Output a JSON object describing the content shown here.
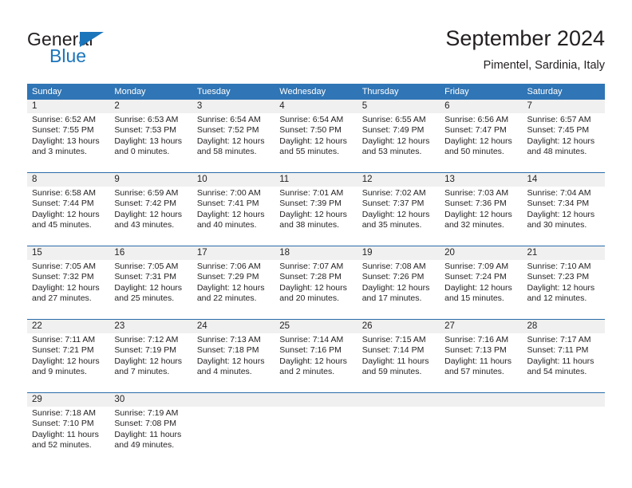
{
  "brand": {
    "name_part1": "General",
    "name_part2": "Blue",
    "color_dark": "#231f20",
    "color_blue": "#1b75bb"
  },
  "header": {
    "title": "September 2024",
    "subtitle": "Pimentel, Sardinia, Italy"
  },
  "theme": {
    "header_blue": "#3075b5",
    "row_divider_blue": "#2a6ca8",
    "daynum_band": "#f0f0f0",
    "text": "#231f20"
  },
  "weekdays": [
    "Sunday",
    "Monday",
    "Tuesday",
    "Wednesday",
    "Thursday",
    "Friday",
    "Saturday"
  ],
  "weeks": [
    [
      {
        "day": "1",
        "info": "Sunrise: 6:52 AM\nSunset: 7:55 PM\nDaylight: 13 hours\nand 3 minutes."
      },
      {
        "day": "2",
        "info": "Sunrise: 6:53 AM\nSunset: 7:53 PM\nDaylight: 13 hours\nand 0 minutes."
      },
      {
        "day": "3",
        "info": "Sunrise: 6:54 AM\nSunset: 7:52 PM\nDaylight: 12 hours\nand 58 minutes."
      },
      {
        "day": "4",
        "info": "Sunrise: 6:54 AM\nSunset: 7:50 PM\nDaylight: 12 hours\nand 55 minutes."
      },
      {
        "day": "5",
        "info": "Sunrise: 6:55 AM\nSunset: 7:49 PM\nDaylight: 12 hours\nand 53 minutes."
      },
      {
        "day": "6",
        "info": "Sunrise: 6:56 AM\nSunset: 7:47 PM\nDaylight: 12 hours\nand 50 minutes."
      },
      {
        "day": "7",
        "info": "Sunrise: 6:57 AM\nSunset: 7:45 PM\nDaylight: 12 hours\nand 48 minutes."
      }
    ],
    [
      {
        "day": "8",
        "info": "Sunrise: 6:58 AM\nSunset: 7:44 PM\nDaylight: 12 hours\nand 45 minutes."
      },
      {
        "day": "9",
        "info": "Sunrise: 6:59 AM\nSunset: 7:42 PM\nDaylight: 12 hours\nand 43 minutes."
      },
      {
        "day": "10",
        "info": "Sunrise: 7:00 AM\nSunset: 7:41 PM\nDaylight: 12 hours\nand 40 minutes."
      },
      {
        "day": "11",
        "info": "Sunrise: 7:01 AM\nSunset: 7:39 PM\nDaylight: 12 hours\nand 38 minutes."
      },
      {
        "day": "12",
        "info": "Sunrise: 7:02 AM\nSunset: 7:37 PM\nDaylight: 12 hours\nand 35 minutes."
      },
      {
        "day": "13",
        "info": "Sunrise: 7:03 AM\nSunset: 7:36 PM\nDaylight: 12 hours\nand 32 minutes."
      },
      {
        "day": "14",
        "info": "Sunrise: 7:04 AM\nSunset: 7:34 PM\nDaylight: 12 hours\nand 30 minutes."
      }
    ],
    [
      {
        "day": "15",
        "info": "Sunrise: 7:05 AM\nSunset: 7:32 PM\nDaylight: 12 hours\nand 27 minutes."
      },
      {
        "day": "16",
        "info": "Sunrise: 7:05 AM\nSunset: 7:31 PM\nDaylight: 12 hours\nand 25 minutes."
      },
      {
        "day": "17",
        "info": "Sunrise: 7:06 AM\nSunset: 7:29 PM\nDaylight: 12 hours\nand 22 minutes."
      },
      {
        "day": "18",
        "info": "Sunrise: 7:07 AM\nSunset: 7:28 PM\nDaylight: 12 hours\nand 20 minutes."
      },
      {
        "day": "19",
        "info": "Sunrise: 7:08 AM\nSunset: 7:26 PM\nDaylight: 12 hours\nand 17 minutes."
      },
      {
        "day": "20",
        "info": "Sunrise: 7:09 AM\nSunset: 7:24 PM\nDaylight: 12 hours\nand 15 minutes."
      },
      {
        "day": "21",
        "info": "Sunrise: 7:10 AM\nSunset: 7:23 PM\nDaylight: 12 hours\nand 12 minutes."
      }
    ],
    [
      {
        "day": "22",
        "info": "Sunrise: 7:11 AM\nSunset: 7:21 PM\nDaylight: 12 hours\nand 9 minutes."
      },
      {
        "day": "23",
        "info": "Sunrise: 7:12 AM\nSunset: 7:19 PM\nDaylight: 12 hours\nand 7 minutes."
      },
      {
        "day": "24",
        "info": "Sunrise: 7:13 AM\nSunset: 7:18 PM\nDaylight: 12 hours\nand 4 minutes."
      },
      {
        "day": "25",
        "info": "Sunrise: 7:14 AM\nSunset: 7:16 PM\nDaylight: 12 hours\nand 2 minutes."
      },
      {
        "day": "26",
        "info": "Sunrise: 7:15 AM\nSunset: 7:14 PM\nDaylight: 11 hours\nand 59 minutes."
      },
      {
        "day": "27",
        "info": "Sunrise: 7:16 AM\nSunset: 7:13 PM\nDaylight: 11 hours\nand 57 minutes."
      },
      {
        "day": "28",
        "info": "Sunrise: 7:17 AM\nSunset: 7:11 PM\nDaylight: 11 hours\nand 54 minutes."
      }
    ],
    [
      {
        "day": "29",
        "info": "Sunrise: 7:18 AM\nSunset: 7:10 PM\nDaylight: 11 hours\nand 52 minutes."
      },
      {
        "day": "30",
        "info": "Sunrise: 7:19 AM\nSunset: 7:08 PM\nDaylight: 11 hours\nand 49 minutes."
      },
      {
        "day": "",
        "info": ""
      },
      {
        "day": "",
        "info": ""
      },
      {
        "day": "",
        "info": ""
      },
      {
        "day": "",
        "info": ""
      },
      {
        "day": "",
        "info": ""
      }
    ]
  ]
}
